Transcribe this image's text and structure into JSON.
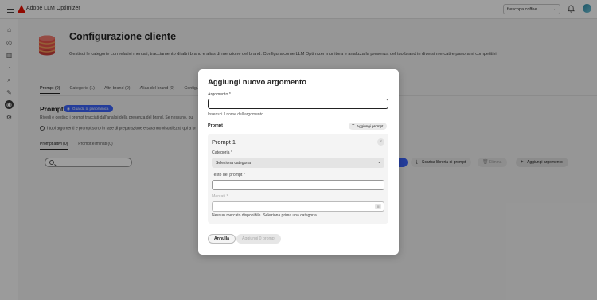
{
  "topbar": {
    "app_title": "Adobe LLM Optimizer",
    "org_select": "frescopa.coffee",
    "icons": [
      "menu-icon",
      "adobe-logo",
      "bell-icon",
      "avatar"
    ]
  },
  "rail": {
    "icons": [
      "home-icon",
      "compass-icon",
      "chart-icon",
      "gauge-icon",
      "search-icon",
      "tools-icon",
      "settings-active-icon",
      "gear-icon"
    ]
  },
  "page": {
    "title": "Configurazione cliente",
    "description": "Gestisci le categorie con relativi mercati, tracciamento di altri brand e alias di menzione del brand. Configura come LLM Optimizer monitora e analizza la presenza del tuo brand in diversi mercati e panorami competitivi"
  },
  "tabs": [
    "Prompt (0)",
    "Categorie (1)",
    "Altri brand (0)",
    "Alias del brand (0)",
    "Configur"
  ],
  "section": {
    "title": "Prompt",
    "pill": "Guarda la panoramica",
    "description": "Rivedi e gestisci i prompt tracciati dall'analisi della presenza del brand. Se nessuno, pu",
    "info": "I tuoi argomenti e prompt sono in fase di preparazione e saranno visualizzati qui a br"
  },
  "subtabs": [
    "Prompt attivi (0)",
    "Prompt eliminati (0)"
  ],
  "actions": {
    "library": "Scarica libreria di prompt",
    "delete": "Elimina",
    "add_topic": "Aggiungi argomento"
  },
  "dialog": {
    "title": "Aggiungi nuovo argomento",
    "topic_label": "Argomento",
    "topic_value": "",
    "topic_help": "Inserisci il nome dell'argomento",
    "prompt_heading": "Prompt",
    "add_prompt": "Aggiungi prompt",
    "card": {
      "title": "Prompt 1",
      "category_label": "Categoria",
      "category_placeholder": "Seleziona categoria",
      "prompt_text_label": "Testo del prompt",
      "markets_label": "Mercati",
      "note": "Nessun mercato disponibile. Seleziona prima una categoria."
    },
    "cancel": "Annulla",
    "submit": "Aggiungi 0 prompt",
    "required_mark": "*"
  }
}
